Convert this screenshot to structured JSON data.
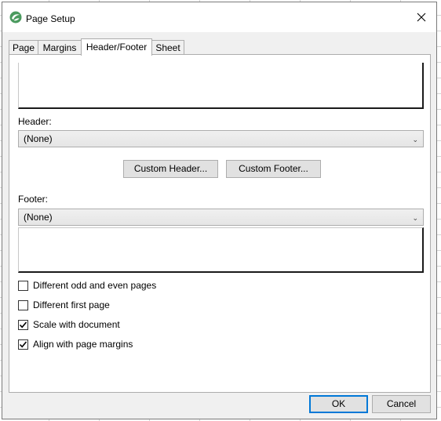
{
  "window": {
    "title": "Page Setup"
  },
  "tabs": [
    {
      "label": "Page",
      "active": false
    },
    {
      "label": "Margins",
      "active": false
    },
    {
      "label": "Header/Footer",
      "active": true
    },
    {
      "label": "Sheet",
      "active": false
    }
  ],
  "header": {
    "label": "Header:",
    "value": "(None)"
  },
  "footer": {
    "label": "Footer:",
    "value": "(None)"
  },
  "buttons": {
    "custom_header": "Custom Header...",
    "custom_footer": "Custom Footer...",
    "ok": "OK",
    "cancel": "Cancel"
  },
  "options": [
    {
      "label": "Different odd and even pages",
      "checked": false
    },
    {
      "label": "Different first page",
      "checked": false
    },
    {
      "label": "Scale with document",
      "checked": true
    },
    {
      "label": "Align with page margins",
      "checked": true
    }
  ],
  "colors": {
    "accent": "#0078d7",
    "app_icon": "#4a9a5e"
  },
  "icons": {
    "app": "app-logo-icon",
    "close": "close-icon",
    "dropdown": "chevron-down-icon",
    "check": "checkmark-icon"
  }
}
